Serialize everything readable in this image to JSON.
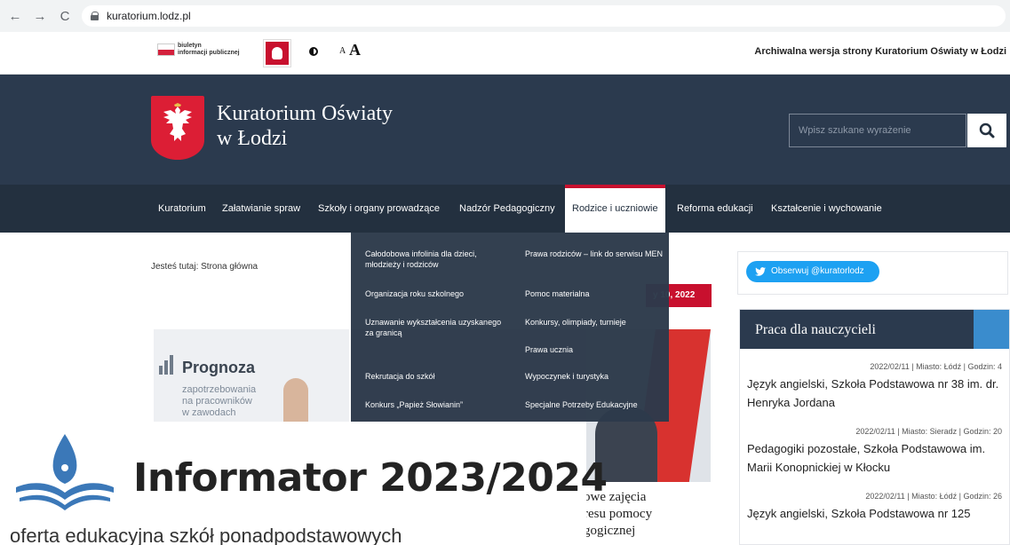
{
  "browser": {
    "url": "kuratorium.lodz.pl"
  },
  "utility": {
    "bip_line1": "biuletyn",
    "bip_line2": "informacji publicznej",
    "font_small": "A",
    "font_big": "A",
    "archive_notice": "Archiwalna wersja strony Kuratorium Oświaty w Łodzi"
  },
  "header": {
    "title_line1": "Kuratorium Oświaty",
    "title_line2": "w Łodzi",
    "search_placeholder": "Wpisz szukane wyrażenie"
  },
  "nav": {
    "items": [
      "Kuratorium",
      "Załatwianie spraw",
      "Szkoły i organy prowadzące",
      "Nadzór Pedagogiczny",
      "Rodzice i uczniowie",
      "Reforma edukacji",
      "Kształcenie i wychowanie"
    ],
    "active_index": 4
  },
  "dropdown": {
    "left": [
      "Całodobowa infolinia dla dzieci, młodzieży i rodziców",
      "Organizacja roku szkolnego",
      "Uznawanie wykształcenia uzyskanego za granicą",
      "Rekrutacja do szkół",
      "Konkurs „Papież Słowianin”"
    ],
    "right": [
      "Prawa rodziców – link do serwisu MEN",
      "Pomoc materialna",
      "Konkursy, olimpiady, turnieje",
      "Prawa ucznia",
      "Wypoczynek i turystyka",
      "Specjalne Potrzeby Edukacyjne"
    ]
  },
  "content": {
    "breadcrumb": "Jesteś tutaj: Strona główna",
    "date_badge": "y 10, 2022",
    "prognoza_title": "Prognoza",
    "prognoza_sub1": "zapotrzebowania",
    "prognoza_sub2": "na pracowników",
    "prognoza_sub3": "w zawodach",
    "article_line1": "owe zajęcia",
    "article_line2": "resu pomocy",
    "article_line3": "gogicznej"
  },
  "informator": {
    "title": "Informator 2023/2024",
    "subtitle": "oferta edukacyjna szkół ponadpodstawowych"
  },
  "sidebar": {
    "twitter_label": "Obserwuj @kuratorlodz",
    "box_title": "Praca dla nauczycieli",
    "jobs": [
      {
        "meta": "2022/02/11 | Miasto: Łódź | Godzin: 4",
        "title": "Język angielski, Szkoła Podstawowa nr 38 im. dr. Henryka Jordana"
      },
      {
        "meta": "2022/02/11 | Miasto: Sieradz | Godzin: 20",
        "title": "Pedagogiki pozostałe, Szkoła Podstawowa im. Marii Konopnickiej w Kłocku"
      },
      {
        "meta": "2022/02/11 | Miasto: Łódź | Godzin: 26",
        "title": "Język angielski, Szkoła Podstawowa nr 125"
      }
    ]
  },
  "colors": {
    "header_bg": "#2b3a4e",
    "nav_bg": "#23303f",
    "accent_red": "#c8102e",
    "twitter_blue": "#1da1f2"
  }
}
